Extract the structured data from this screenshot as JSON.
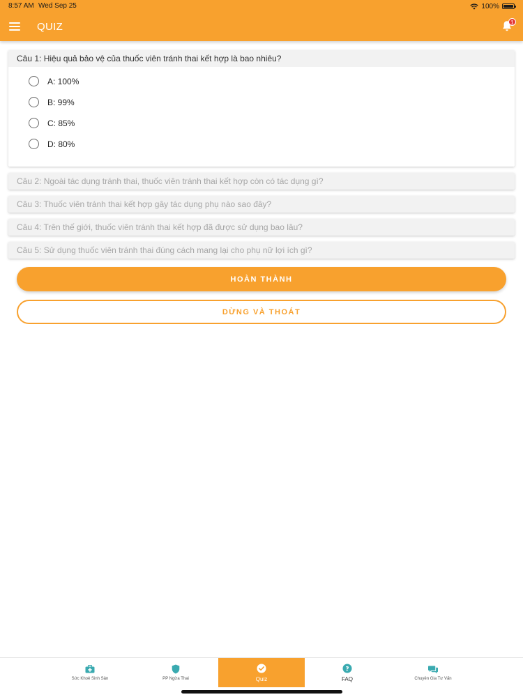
{
  "status_bar": {
    "time": "8:57 AM",
    "date": "Wed Sep 25",
    "battery_pct": "100%"
  },
  "app_bar": {
    "title": "QUIZ",
    "notification_count": "1"
  },
  "questions": [
    {
      "title": "Câu 1: Hiệu quả bảo vệ của thuốc viên tránh thai kết hợp là bao nhiêu?",
      "expanded": true,
      "options": [
        "A: 100%",
        "B: 99%",
        "C: 85%",
        "D: 80%"
      ]
    },
    {
      "title": "Câu 2: Ngoài tác dụng tránh thai, thuốc viên tránh thai kết hợp còn có tác dụng gì?",
      "expanded": false
    },
    {
      "title": "Câu 3: Thuốc viên tránh thai kết hợp gây tác dụng phụ nào sao đây?",
      "expanded": false
    },
    {
      "title": "Câu 4: Trên thế giới, thuốc viên tránh thai kết hợp đã được sử dụng bao lâu?",
      "expanded": false
    },
    {
      "title": "Câu 5: Sử dụng thuốc viên tránh thai đúng cách mang lại cho phụ nữ lợi ích gì?",
      "expanded": false
    }
  ],
  "actions": {
    "finish": "HOÀN THÀNH",
    "stop_exit": "DỪNG VÀ THOÁT"
  },
  "tabs": [
    {
      "label": "Sức Khoẻ Sinh Sản",
      "icon": "medical-kit-icon",
      "active": false
    },
    {
      "label": "PP Ngừa Thai",
      "icon": "shield-icon",
      "active": false
    },
    {
      "label": "Quiz",
      "icon": "check-circle-icon",
      "active": true
    },
    {
      "label": "FAQ",
      "icon": "question-circle-icon",
      "active": false
    },
    {
      "label": "Chuyên Gia Tư Vấn",
      "icon": "chat-bubbles-icon",
      "active": false
    }
  ],
  "colors": {
    "accent": "#f8a12e",
    "tab_icon": "#3aaab0",
    "badge": "#e53935"
  }
}
